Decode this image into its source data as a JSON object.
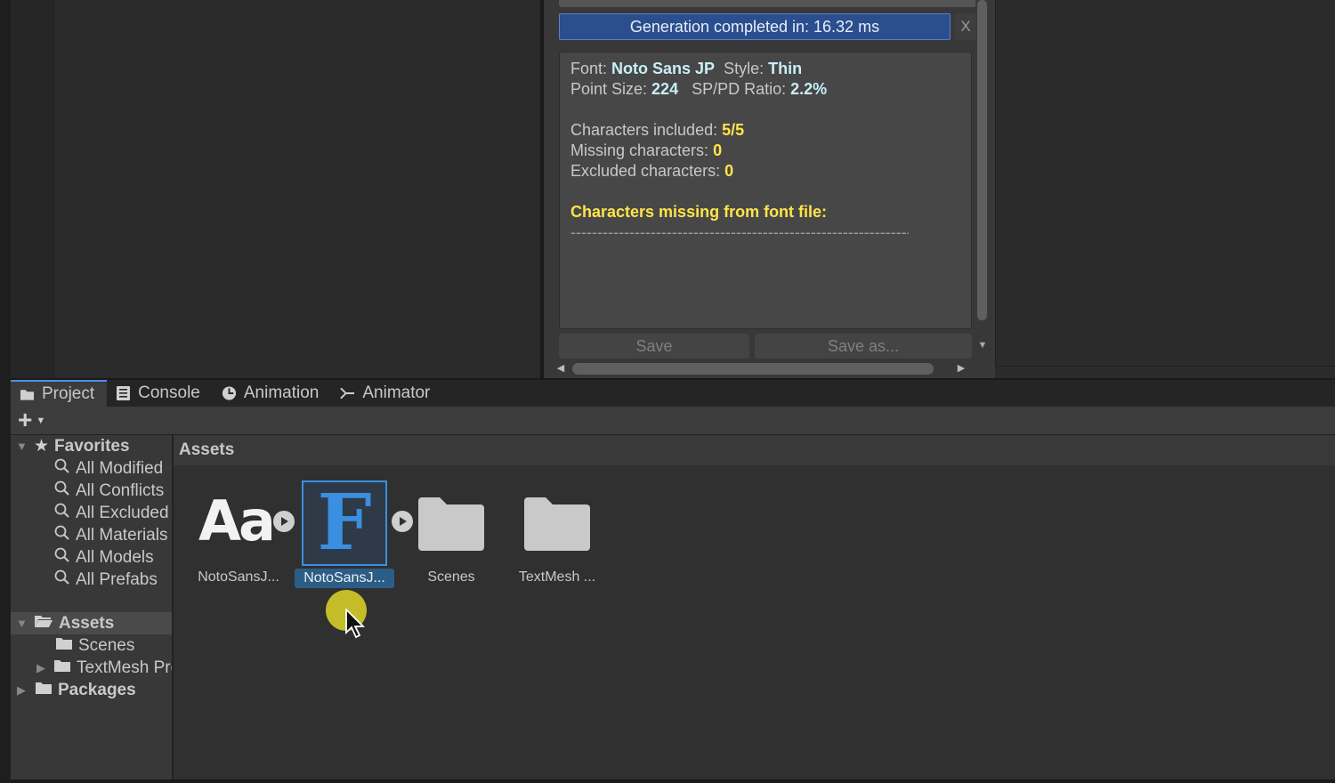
{
  "generation": {
    "status_text": "Generation completed in: 16.32 ms",
    "close_label": "X"
  },
  "report": {
    "font_label": "Font: ",
    "font_value": "Noto Sans JP",
    "style_label": "Style: ",
    "style_value": "Thin",
    "point_size_label": "Point Size: ",
    "point_size_value": "224",
    "ratio_label": "SP/PD Ratio: ",
    "ratio_value": "2.2%",
    "included_label": "Characters included: ",
    "included_value": "5/5",
    "missing_label": "Missing characters: ",
    "missing_value": "0",
    "excluded_label": "Excluded characters: ",
    "excluded_value": "0",
    "missing_title": "Characters missing from font file:",
    "dashes": "----------------------------------------------------------------------"
  },
  "buttons": {
    "save": "Save",
    "save_as": "Save as..."
  },
  "tabs": [
    {
      "label": "Project",
      "icon": "folder-icon"
    },
    {
      "label": "Console",
      "icon": "console-icon"
    },
    {
      "label": "Animation",
      "icon": "clock-icon"
    },
    {
      "label": "Animator",
      "icon": "animator-icon"
    }
  ],
  "tree": {
    "favorites": "Favorites",
    "favorite_items": [
      "All Modified",
      "All Conflicts",
      "All Excluded",
      "All Materials",
      "All Models",
      "All Prefabs"
    ],
    "assets": "Assets",
    "scenes": "Scenes",
    "textmesh": "TextMesh Pro",
    "packages": "Packages"
  },
  "assets_panel": {
    "header": "Assets",
    "items": [
      {
        "label": "NotoSansJ...",
        "icon": "font-file-icon"
      },
      {
        "label": "NotoSansJ...",
        "icon": "font-asset-icon"
      },
      {
        "label": "Scenes",
        "icon": "folder-icon"
      },
      {
        "label": "TextMesh ...",
        "icon": "folder-icon"
      }
    ]
  },
  "colors": {
    "accent_blue": "#2a4e8e",
    "value_cyan": "#c9eef8",
    "value_yellow": "#ffe44a",
    "selection": "#2c5d87",
    "font_asset_blue": "#3b8fe0"
  }
}
